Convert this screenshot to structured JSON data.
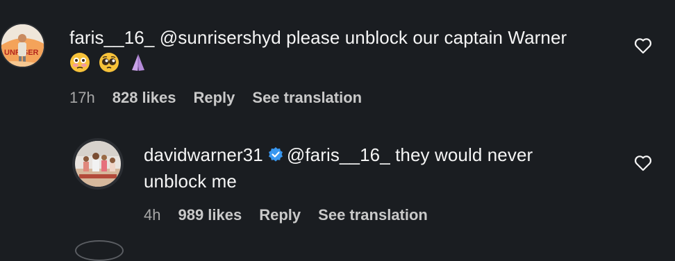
{
  "comments": [
    {
      "username": "faris__16_",
      "mention": "@sunrisershyd",
      "text": " please unblock our captain Warner",
      "emoji": [
        "flushed-face",
        "pleading-face",
        "folded-hands"
      ],
      "time": "17h",
      "likes": "828 likes",
      "reply_label": "Reply",
      "translate_label": "See translation",
      "avatar_icon": "profile-photo-icon",
      "like_icon": "heart-outline-icon"
    },
    {
      "username": "davidwarner31",
      "verified": true,
      "mention": "@faris__16_",
      "text_line1": " they would never",
      "text_line2": "unblock me",
      "time": "4h",
      "likes": "989 likes",
      "reply_label": "Reply",
      "translate_label": "See translation",
      "avatar_icon": "profile-photo-icon",
      "like_icon": "heart-outline-icon"
    }
  ],
  "colors": {
    "background": "#1a1d21",
    "text": "#f5f5f5",
    "meta": "#a8a8a8",
    "verified": "#3897f0"
  }
}
